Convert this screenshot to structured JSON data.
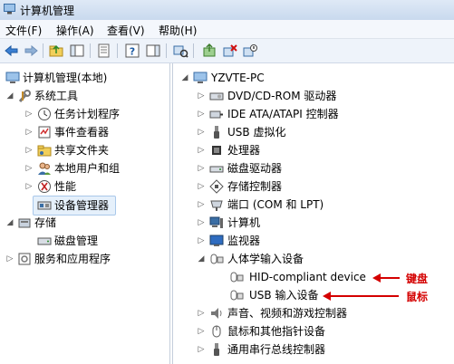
{
  "window": {
    "title": "计算机管理"
  },
  "menu": [
    "文件(F)",
    "操作(A)",
    "查看(V)",
    "帮助(H)"
  ],
  "toolbar": [
    "back-icon",
    "forward-icon",
    "folder-up-icon",
    "console-tree-icon",
    "export-list-icon",
    "help-icon",
    "show-hide-icon",
    "scan-hardware-icon",
    "update-driver-icon",
    "uninstall-icon",
    "disable-device-icon"
  ],
  "left_tree": {
    "root": "计算机管理(本地)",
    "system_tools": "系统工具",
    "task_scheduler": "任务计划程序",
    "event_viewer": "事件查看器",
    "shared_folders": "共享文件夹",
    "local_users": "本地用户和组",
    "performance": "性能",
    "device_manager": "设备管理器",
    "storage": "存储",
    "disk_management": "磁盘管理",
    "services": "服务和应用程序"
  },
  "device_tree": {
    "computer": "YZVTE-PC",
    "categories": [
      {
        "label": "DVD/CD-ROM 驱动器",
        "icon": "dvd-drive-icon"
      },
      {
        "label": "IDE ATA/ATAPI 控制器",
        "icon": "ide-controller-icon"
      },
      {
        "label": "USB 虚拟化",
        "icon": "usb-icon"
      },
      {
        "label": "处理器",
        "icon": "processor-icon"
      },
      {
        "label": "磁盘驱动器",
        "icon": "disk-drive-icon"
      },
      {
        "label": "存储控制器",
        "icon": "storage-controller-icon"
      },
      {
        "label": "端口 (COM 和 LPT)",
        "icon": "port-icon"
      },
      {
        "label": "计算机",
        "icon": "computer-icon"
      },
      {
        "label": "监视器",
        "icon": "monitor-icon"
      },
      {
        "label": "人体学输入设备",
        "icon": "hid-icon"
      },
      {
        "label": "声音、视频和游戏控制器",
        "icon": "sound-icon"
      },
      {
        "label": "鼠标和其他指针设备",
        "icon": "mouse-icon"
      },
      {
        "label": "通用串行总线控制器",
        "icon": "usb-controller-icon"
      }
    ],
    "hid_children": [
      "HID-compliant device",
      "USB 输入设备"
    ]
  },
  "annotations": {
    "keyboard": "键盘",
    "mouse": "鼠标"
  }
}
